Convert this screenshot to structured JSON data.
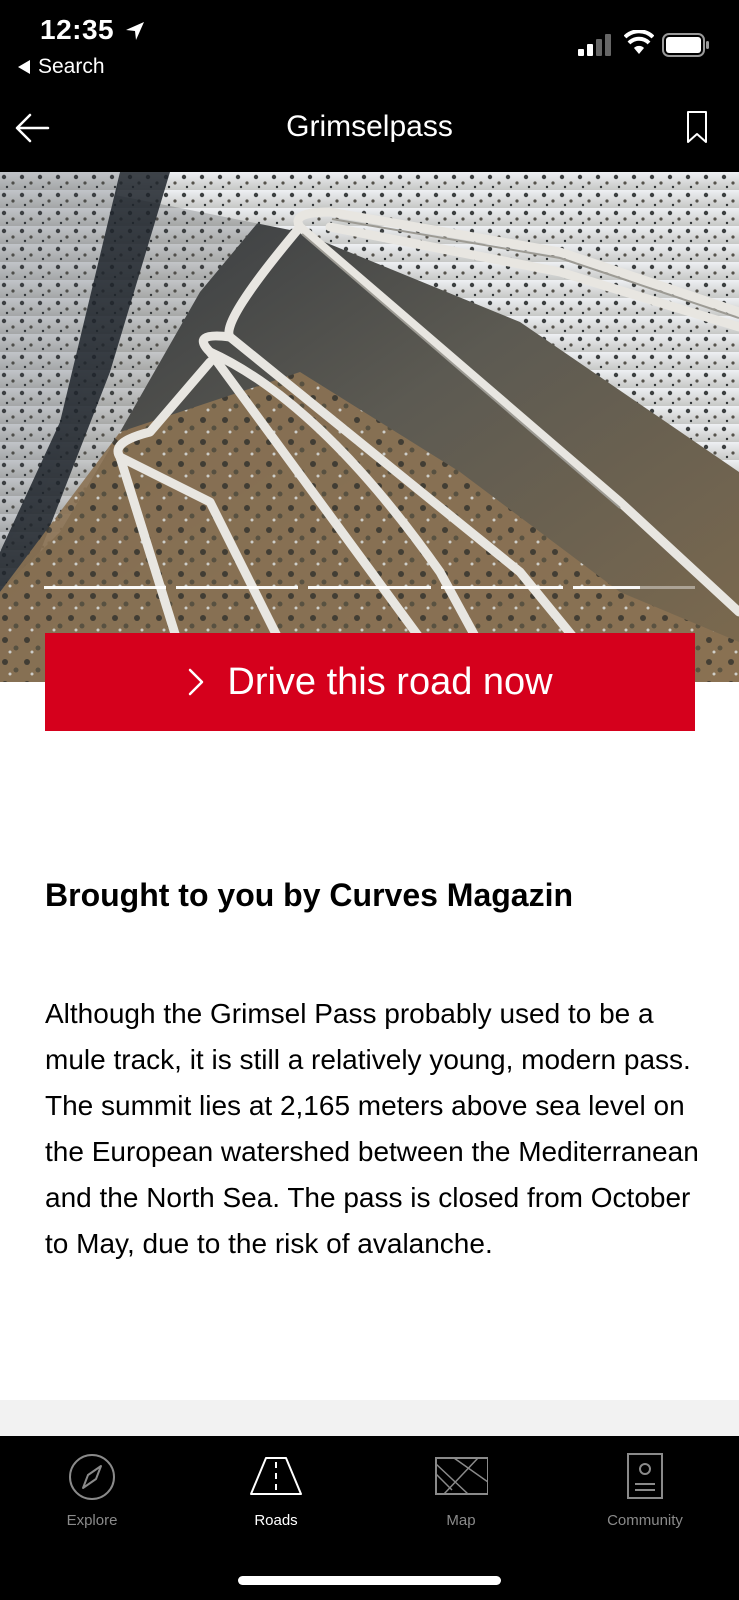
{
  "status_bar": {
    "time": "12:35",
    "back_app_label": "Search"
  },
  "nav": {
    "title": "Grimselpass",
    "back_icon": "arrow-left-icon",
    "bookmark_icon": "bookmark-icon"
  },
  "hero": {
    "image_subject": "aerial view of snowy mountain pass with switchback roads",
    "pager_pages": 5,
    "pager_current": 5
  },
  "cta": {
    "label": "Drive this road now",
    "color": "#d5001c"
  },
  "content": {
    "heading": "Brought to you by Curves Magazin",
    "body": "Although the Grimsel Pass probably used to be a mule track, it is still a relatively young, modern pass. The summit lies at 2,165 meters above sea level on the European watershed between the Mediterranean and the North Sea. The pass is closed from October to May, due to the risk of avalanche."
  },
  "tab_bar": {
    "tabs": [
      {
        "label": "Explore",
        "icon": "compass-icon",
        "active": false
      },
      {
        "label": "Roads",
        "icon": "road-icon",
        "active": true
      },
      {
        "label": "Map",
        "icon": "map-icon",
        "active": false
      },
      {
        "label": "Community",
        "icon": "profile-card-icon",
        "active": false
      }
    ]
  }
}
